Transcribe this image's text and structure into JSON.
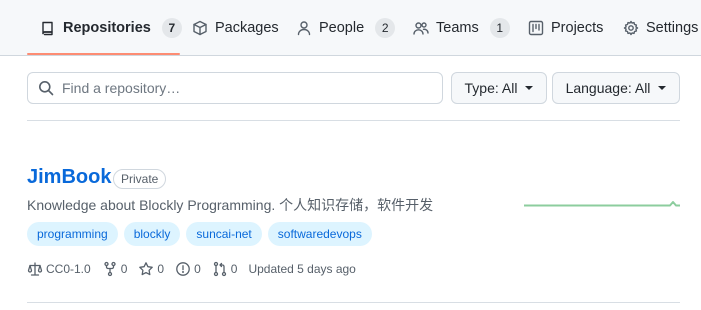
{
  "tabs": [
    {
      "label": "Repositories",
      "count": "7",
      "icon": "repo-icon",
      "selected": true
    },
    {
      "label": "Packages",
      "icon": "package-icon"
    },
    {
      "label": "People",
      "count": "2",
      "icon": "person-icon"
    },
    {
      "label": "Teams",
      "count": "1",
      "icon": "people-icon"
    },
    {
      "label": "Projects",
      "icon": "project-icon"
    },
    {
      "label": "Settings",
      "icon": "gear-icon"
    }
  ],
  "filters": {
    "search_placeholder": "Find a repository…",
    "type_label": "Type: All",
    "language_label": "Language: All"
  },
  "repo": {
    "name": "JimBook",
    "visibility": "Private",
    "description": "Knowledge about Blockly Programming. 个人知识存储，软件开发",
    "topics": [
      "programming",
      "blockly",
      "suncai-net",
      "softwaredevops"
    ],
    "license": "CC0-1.0",
    "forks": "0",
    "stars": "0",
    "issues": "0",
    "pull_requests": "0",
    "updated": "Updated 5 days ago",
    "activity_color": "#2da44e"
  },
  "colors": {
    "accent": "#0969da",
    "tab_underline": "#fd8c73",
    "topic_bg": "#ddf4ff"
  }
}
